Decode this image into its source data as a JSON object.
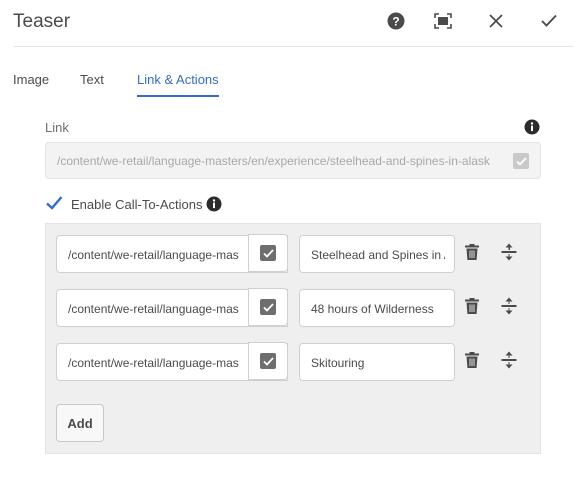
{
  "dialog": {
    "title": "Teaser"
  },
  "header_icons": [
    "help-icon",
    "fullscreen-icon",
    "close-icon",
    "done-icon"
  ],
  "tabs": [
    {
      "label": "Image",
      "active": false
    },
    {
      "label": "Text",
      "active": false
    },
    {
      "label": "Link & Actions",
      "active": true
    }
  ],
  "link": {
    "label": "Link",
    "value": "/content/we-retail/language-masters/en/experience/steelhead-and-spines-in-alask",
    "disabled": true
  },
  "cta": {
    "label": "Enable Call-To-Actions",
    "checked": true,
    "rows": [
      {
        "path": "/content/we-retail/language-mas",
        "text": "Steelhead and Spines in Ala",
        "path_checked": true
      },
      {
        "path": "/content/we-retail/language-mas",
        "text": "48 hours of Wilderness",
        "path_checked": true
      },
      {
        "path": "/content/we-retail/language-mas",
        "text": "Skitouring",
        "path_checked": true
      }
    ],
    "add_label": "Add"
  },
  "colors": {
    "accent": "#326ec8",
    "panel": "#efefef",
    "checkbox": "#6e6e6e"
  }
}
